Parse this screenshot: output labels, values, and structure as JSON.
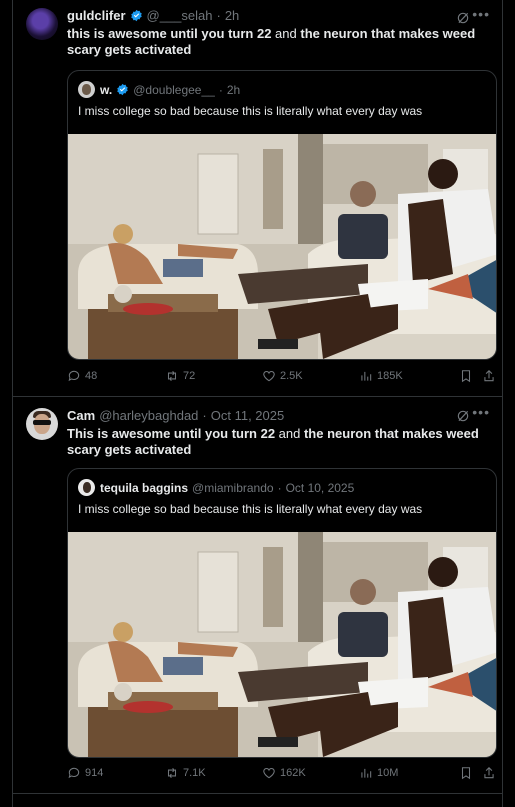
{
  "posts": [
    {
      "author": {
        "name": "guldclifer",
        "handle": "@___selah",
        "time": "2h",
        "verified": true
      },
      "text_parts": [
        {
          "text": "this is awesome until you turn 22"
        },
        {
          "text": " and "
        },
        {
          "text": "the neuron that makes weed scary gets activated"
        }
      ],
      "quote": {
        "name": "w.",
        "handle": "@doublegee__",
        "time": "2h",
        "verified": true,
        "text": "I miss college so bad because this is literally what every day was"
      },
      "stats": {
        "replies": "48",
        "reposts": "72",
        "likes": "2.5K",
        "views": "185K"
      }
    },
    {
      "author": {
        "name": "Cam",
        "handle": "@harleybaghdad",
        "time": "Oct 11, 2025",
        "verified": false
      },
      "text_parts": [
        {
          "text": "This is awesome until you turn 22"
        },
        {
          "text": " and "
        },
        {
          "text": "the neuron that makes weed scary gets activated"
        }
      ],
      "quote": {
        "name": "tequila baggins",
        "handle": "@miamibrando",
        "time": "Oct 10, 2025",
        "verified": false,
        "text": "I miss college so bad because this is literally what every day was"
      },
      "stats": {
        "replies": "914",
        "reposts": "7.1K",
        "likes": "162K",
        "views": "10M"
      }
    }
  ],
  "icons": {
    "more": "more-icon",
    "grok": "grok-icon",
    "reply": "reply-icon",
    "repost": "repost-icon",
    "like": "heart-icon",
    "views": "views-icon",
    "bookmark": "bookmark-icon",
    "share": "share-icon"
  },
  "colors": {
    "background": "#000000",
    "text": "#e7e9ea",
    "muted": "#71767b",
    "border": "#2f3336",
    "verified": "#1d9bf0"
  }
}
